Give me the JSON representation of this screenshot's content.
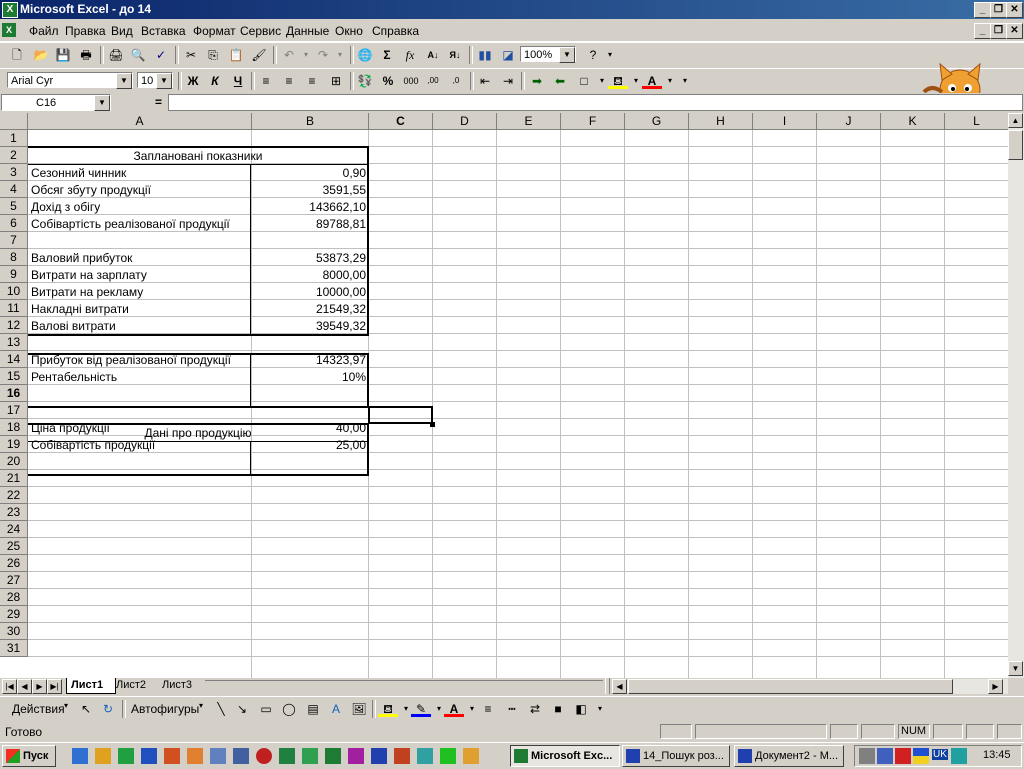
{
  "window": {
    "title": "Microsoft Excel - до 14"
  },
  "menu": [
    "Файл",
    "Правка",
    "Вид",
    "Вставка",
    "Формат",
    "Сервис",
    "Данные",
    "Окно",
    "Справка"
  ],
  "toolbar": {
    "zoom": "100%",
    "font": "Arial Cyr",
    "size": "10",
    "bold": "Ж",
    "italic": "К",
    "underline": "Ч"
  },
  "formula": {
    "name_box": "C16",
    "equals": "=",
    "content": ""
  },
  "columns": [
    "A",
    "B",
    "C",
    "D",
    "E",
    "F",
    "G",
    "H",
    "I",
    "J",
    "K",
    "L"
  ],
  "rows": [
    "1",
    "2",
    "3",
    "4",
    "5",
    "6",
    "7",
    "8",
    "9",
    "10",
    "11",
    "12",
    "13",
    "14",
    "15",
    "16",
    "17",
    "18",
    "19",
    "20",
    "21",
    "22",
    "23",
    "24",
    "25",
    "26",
    "27",
    "28",
    "29",
    "30",
    "31"
  ],
  "sheet": {
    "header1": "Заплановані показники",
    "header2": "Дані про продукцію",
    "items": [
      {
        "row": 3,
        "label": "Сезонний чинник",
        "value": "0,90"
      },
      {
        "row": 4,
        "label": "Обсяг збуту продукції",
        "value": "3591,55"
      },
      {
        "row": 5,
        "label": "Дохід з обігу",
        "value": "143662,10"
      },
      {
        "row": 6,
        "label": "Собівартість реалізованої продукції",
        "value": "89788,81"
      },
      {
        "row": 8,
        "label": "Валовий прибуток",
        "value": "53873,29"
      },
      {
        "row": 9,
        "label": "Витрати на зарплату",
        "value": "8000,00"
      },
      {
        "row": 10,
        "label": "Витрати на рекламу",
        "value": "10000,00"
      },
      {
        "row": 11,
        "label": "Накладні витрати",
        "value": "21549,32"
      },
      {
        "row": 12,
        "label": "Валові витрати",
        "value": "39549,32"
      },
      {
        "row": 14,
        "label": "Прибуток від реалізованої продукції",
        "value": "14323,97"
      },
      {
        "row": 15,
        "label": "Рентабельність",
        "value": "10%"
      },
      {
        "row": 18,
        "label": "Ціна продукції",
        "value": "40,00"
      },
      {
        "row": 19,
        "label": "Собівартість продукції",
        "value": "25,00"
      }
    ]
  },
  "tabs": [
    "Лист1",
    "Лист2",
    "Лист3"
  ],
  "drawing": {
    "actions": "Действия",
    "autoshapes": "Автофигуры"
  },
  "status": {
    "ready": "Готово",
    "num": "NUM"
  },
  "taskbar": {
    "start": "Пуск",
    "tasks": [
      "Microsoft Exc...",
      "14_Пошук роз...",
      "Документ2 - М..."
    ],
    "lang": "UK",
    "clock": "13:45"
  }
}
